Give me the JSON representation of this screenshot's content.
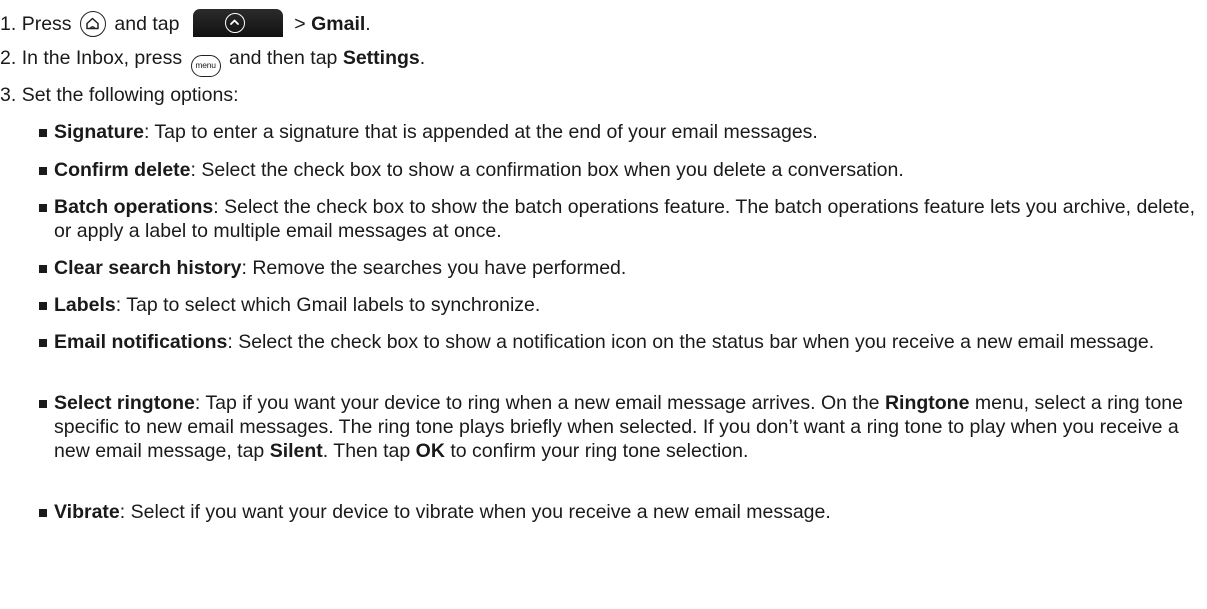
{
  "steps": [
    {
      "number": "1.",
      "press": "Press",
      "and_tap": "and tap",
      "arrow": ">",
      "app": "Gmail",
      "end": "."
    },
    {
      "number": "2.",
      "before": "In the Inbox, press",
      "menu_label": "menu",
      "mid": "and then tap",
      "target": "Settings",
      "end": "."
    },
    {
      "number": "3.",
      "text": "Set the following options:"
    }
  ],
  "icons": {
    "home": "home-key-icon",
    "apps": "all-apps-tab-icon",
    "menu": "menu-key-icon"
  },
  "options": [
    {
      "term": "Signature",
      "desc": ": Tap to enter a signature that is appended at the end of your email messages."
    },
    {
      "term": "Confirm delete",
      "desc": ": Select the check box to show a confirmation box when you delete a conversation."
    },
    {
      "term": "Batch operations",
      "desc": ": Select the check box to show the batch operations feature. The batch operations feature lets you archive, delete, or apply a label to multiple email messages at once."
    },
    {
      "term": "Clear search history",
      "desc": ": Remove the searches you have performed."
    },
    {
      "term": "Labels",
      "desc": ": Tap to select which Gmail labels to synchronize."
    },
    {
      "term": "Email notifications",
      "desc": ": Select the check box to show a notification icon on the status bar when you receive a new email message."
    },
    {
      "term": "Select ringtone",
      "desc_parts": [
        ": Tap if you want your device to ring when a new email message arrives. On the ",
        "Ringtone",
        " menu, select a ring tone specific to new email messages. The ring tone plays briefly when selected. If you don’t want a ring tone to play when you receive a new email message, tap ",
        "Silent",
        ". Then tap ",
        "OK",
        " to confirm your ring tone selection."
      ]
    },
    {
      "term": "Vibrate",
      "desc": ": Select if you want your device to vibrate when you receive a new email message."
    }
  ]
}
